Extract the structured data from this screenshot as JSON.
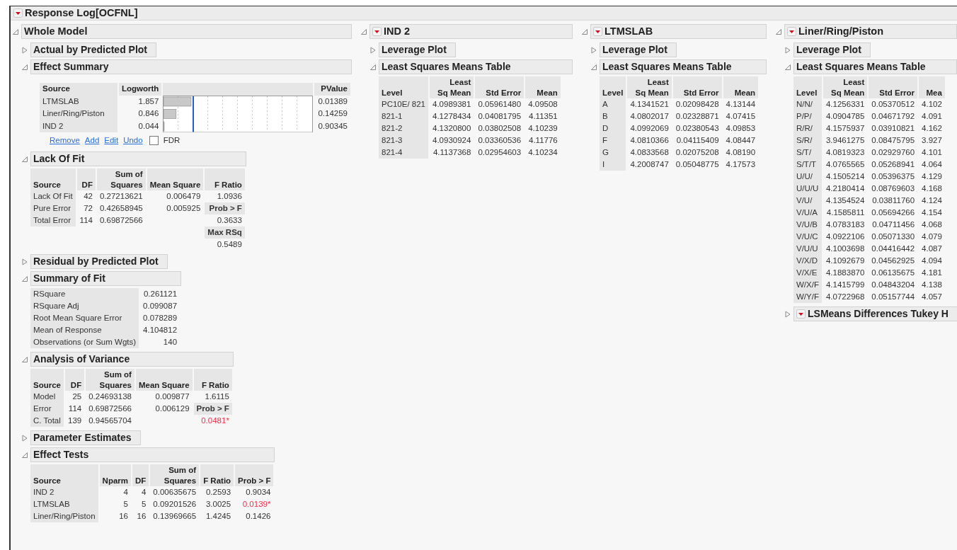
{
  "report": {
    "title": "Response Log[OCFNL]",
    "menu": true
  },
  "panels": [
    {
      "title": "Whole Model",
      "expanded": true,
      "menu": false,
      "sections": [
        {
          "kind": "outline",
          "title": "Actual by Predicted Plot",
          "expanded": false,
          "menu": false
        },
        {
          "kind": "effect_summary",
          "title": "Effect Summary",
          "expanded": true,
          "menu": false,
          "columns": [
            "Source",
            "Logworth",
            "PValue"
          ],
          "rows": [
            {
              "source": "LTMSLAB",
              "logworth": "1.857",
              "pvalue": "0.01389"
            },
            {
              "source": "Liner/Ring/Piston",
              "logworth": "0.846",
              "pvalue": "0.14259"
            },
            {
              "source": "IND 2",
              "logworth": "0.044",
              "pvalue": "0.90345"
            }
          ],
          "links": [
            "Remove",
            "Add",
            "Edit",
            "Undo"
          ],
          "fdr": {
            "label": "FDR",
            "checked": false
          }
        },
        {
          "kind": "table",
          "title": "Lack Of Fit",
          "expanded": true,
          "menu": false,
          "columns": [
            {
              "kind": "label",
              "header": [
                "Source"
              ],
              "cells": [
                "Lack Of Fit",
                "Pure Error",
                "Total Error"
              ]
            },
            {
              "kind": "value",
              "header": [
                "DF"
              ],
              "cells": [
                "42",
                "72",
                "114"
              ]
            },
            {
              "kind": "value",
              "header": [
                "Sum of",
                "Squares"
              ],
              "cells": [
                "0.27213621",
                "0.42658945",
                "0.69872566"
              ]
            },
            {
              "kind": "value",
              "header": [
                "Mean Square"
              ],
              "cells": [
                "0.006479",
                "0.005925"
              ]
            },
            {
              "kind": "value",
              "header": [
                "F Ratio"
              ],
              "cells": [
                "1.0936",
                {
                  "text": "Prob > F",
                  "kind": "label"
                },
                "0.3633",
                {
                  "text": "Max RSq",
                  "kind": "label"
                },
                "0.5489"
              ]
            }
          ]
        },
        {
          "kind": "outline",
          "title": "Residual by Predicted Plot",
          "expanded": false,
          "menu": false
        },
        {
          "kind": "table",
          "title": "Summary of Fit",
          "expanded": true,
          "menu": false,
          "columns": [
            {
              "kind": "label",
              "cells": [
                "RSquare",
                "RSquare Adj",
                "Root Mean Square Error",
                "Mean of Response",
                "Observations (or Sum Wgts)"
              ]
            },
            {
              "kind": "value",
              "cells": [
                "0.261121",
                "0.099087",
                "0.078289",
                "4.104812",
                "140"
              ]
            }
          ]
        },
        {
          "kind": "table",
          "title": "Analysis of Variance",
          "expanded": true,
          "menu": false,
          "columns": [
            {
              "kind": "label",
              "header": [
                "Source"
              ],
              "cells": [
                "Model",
                "Error",
                "C. Total"
              ]
            },
            {
              "kind": "value",
              "header": [
                "DF"
              ],
              "cells": [
                "25",
                "114",
                "139"
              ]
            },
            {
              "kind": "value",
              "header": [
                "Sum of",
                "Squares"
              ],
              "cells": [
                "0.24693138",
                "0.69872566",
                "0.94565704"
              ]
            },
            {
              "kind": "value",
              "header": [
                "Mean Square"
              ],
              "cells": [
                "0.009877",
                "0.006129"
              ]
            },
            {
              "kind": "value",
              "header": [
                "F Ratio"
              ],
              "cells": [
                "1.6115",
                {
                  "text": "Prob > F",
                  "kind": "label"
                },
                {
                  "text": "0.0481*",
                  "kind": "significant"
                }
              ]
            }
          ]
        },
        {
          "kind": "outline",
          "title": "Parameter Estimates",
          "expanded": false,
          "menu": false
        },
        {
          "kind": "table",
          "title": "Effect Tests",
          "expanded": true,
          "menu": false,
          "columns": [
            {
              "kind": "label",
              "header": [
                "Source"
              ],
              "cells": [
                "IND 2",
                "LTMSLAB",
                "Liner/Ring/Piston"
              ]
            },
            {
              "kind": "value",
              "header": [
                "Nparm"
              ],
              "cells": [
                "4",
                "5",
                "16"
              ]
            },
            {
              "kind": "value",
              "header": [
                "DF"
              ],
              "cells": [
                "4",
                "5",
                "16"
              ]
            },
            {
              "kind": "value",
              "header": [
                "Sum of",
                "Squares"
              ],
              "cells": [
                "0.00635675",
                "0.09201526",
                "0.13969665"
              ]
            },
            {
              "kind": "value",
              "header": [
                "F Ratio"
              ],
              "cells": [
                "0.2593",
                "3.0025",
                "1.4245"
              ]
            },
            {
              "kind": "value",
              "header": [
                "Prob > F"
              ],
              "cells": [
                "0.9034",
                {
                  "text": "0.0139*",
                  "kind": "significant"
                },
                "0.1426"
              ]
            }
          ]
        }
      ]
    },
    {
      "title": "IND 2",
      "expanded": true,
      "menu": true,
      "sections": [
        {
          "kind": "outline",
          "title": "Leverage Plot",
          "expanded": false,
          "menu": false
        },
        {
          "kind": "table",
          "title": "Least Squares Means Table",
          "expanded": true,
          "menu": false,
          "columns": [
            {
              "kind": "label",
              "header": [
                "Level"
              ],
              "cells": [
                "PC10E/ 821",
                "821-1",
                "821-2",
                "821-3",
                "821-4"
              ]
            },
            {
              "kind": "value",
              "header": [
                "Least",
                "Sq Mean"
              ],
              "cells": [
                "4.0989381",
                "4.1278434",
                "4.1320800",
                "4.0930924",
                "4.1137368"
              ]
            },
            {
              "kind": "value",
              "header": [
                "Std Error"
              ],
              "cells": [
                "0.05961480",
                "0.04081795",
                "0.03802508",
                "0.03360536",
                "0.02954603"
              ]
            },
            {
              "kind": "value",
              "header": [
                "Mean"
              ],
              "cells": [
                "4.09508",
                "4.11351",
                "4.10239",
                "4.11776",
                "4.10234"
              ]
            }
          ]
        }
      ]
    },
    {
      "title": "LTMSLAB",
      "expanded": true,
      "menu": true,
      "sections": [
        {
          "kind": "outline",
          "title": "Leverage Plot",
          "expanded": false,
          "menu": false
        },
        {
          "kind": "table",
          "title": "Least Squares Means Table",
          "expanded": true,
          "menu": false,
          "columns": [
            {
              "kind": "label",
              "header": [
                "Level"
              ],
              "cells": [
                "A",
                "B",
                "D",
                "F",
                "G",
                "I"
              ]
            },
            {
              "kind": "value",
              "header": [
                "Least",
                "Sq Mean"
              ],
              "cells": [
                "4.1341521",
                "4.0802017",
                "4.0992069",
                "4.0810366",
                "4.0833568",
                "4.2008747"
              ]
            },
            {
              "kind": "value",
              "header": [
                "Std Error"
              ],
              "cells": [
                "0.02098428",
                "0.02328871",
                "0.02380543",
                "0.04115409",
                "0.02075208",
                "0.05048775"
              ]
            },
            {
              "kind": "value",
              "header": [
                "Mean"
              ],
              "cells": [
                "4.13144",
                "4.07415",
                "4.09853",
                "4.08447",
                "4.08190",
                "4.17573"
              ]
            }
          ]
        }
      ]
    },
    {
      "title": "Liner/Ring/Piston",
      "expanded": true,
      "menu": true,
      "sections": [
        {
          "kind": "outline",
          "title": "Leverage Plot",
          "expanded": false,
          "menu": false
        },
        {
          "kind": "table",
          "title": "Least Squares Means Table",
          "expanded": true,
          "menu": false,
          "columns": [
            {
              "kind": "label",
              "header": [
                "Level"
              ],
              "cells": [
                "N/N/",
                "P/P/",
                "R/R/",
                "S/R/",
                "S/T/",
                "S/T/T",
                "U/U/",
                "U/U/U",
                "V/U/",
                "V/U/A",
                "V/U/B",
                "V/U/C",
                "V/U/U",
                "V/X/D",
                "V/X/E",
                "W/X/F",
                "W/Y/F"
              ]
            },
            {
              "kind": "value",
              "header": [
                "Least",
                "Sq Mean"
              ],
              "cells": [
                "4.1256331",
                "4.0904785",
                "4.1575937",
                "3.9461275",
                "4.0819323",
                "4.0765565",
                "4.1505214",
                "4.2180414",
                "4.1354524",
                "4.1585811",
                "4.0783183",
                "4.0922106",
                "4.1003698",
                "4.1092679",
                "4.1883870",
                "4.1415799",
                "4.0722968"
              ]
            },
            {
              "kind": "value",
              "header": [
                "Std Error"
              ],
              "cells": [
                "0.05370512",
                "0.04671792",
                "0.03910821",
                "0.08475795",
                "0.02929760",
                "0.05268941",
                "0.05396375",
                "0.08769603",
                "0.03811760",
                "0.05694266",
                "0.04711456",
                "0.05071330",
                "0.04416442",
                "0.04562925",
                "0.06135675",
                "0.04843204",
                "0.05157744"
              ]
            },
            {
              "kind": "cut",
              "header": [
                "Mea"
              ],
              "cells": [
                "4.102",
                "4.091",
                "4.162",
                "3.927",
                "4.101",
                "4.064",
                "4.129",
                "4.168",
                "4.124",
                "4.154",
                "4.068",
                "4.079",
                "4.087",
                "4.094",
                "4.181",
                "4.138",
                "4.057"
              ]
            }
          ]
        },
        {
          "kind": "outline",
          "title": "LSMeans Differences Tukey H",
          "expanded": false,
          "menu": true
        }
      ]
    }
  ]
}
